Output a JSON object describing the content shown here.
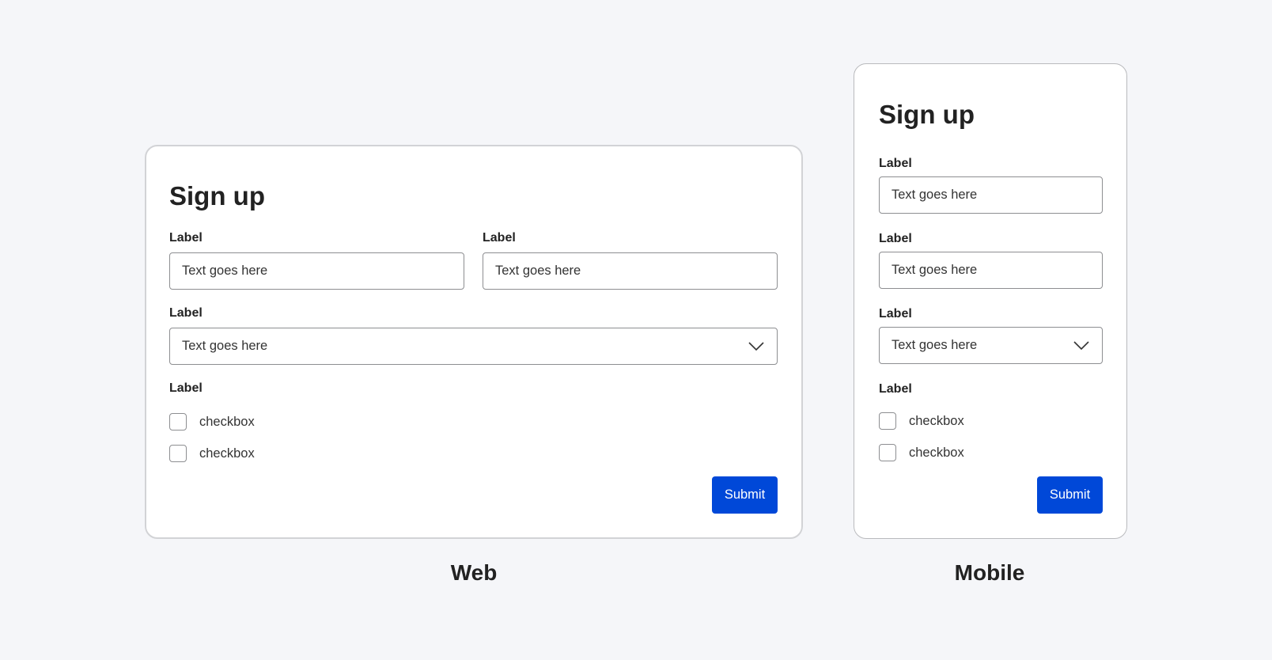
{
  "web": {
    "title": "Sign up",
    "fields": [
      {
        "label": "Label",
        "value": "Text goes here"
      },
      {
        "label": "Label",
        "value": "Text goes here"
      }
    ],
    "select": {
      "label": "Label",
      "value": "Text goes here"
    },
    "checkbox_group": {
      "label": "Label",
      "options": [
        "checkbox",
        "checkbox"
      ]
    },
    "submit_label": "Submit",
    "caption": "Web"
  },
  "mobile": {
    "title": "Sign up",
    "fields": [
      {
        "label": "Label",
        "value": "Text goes here"
      },
      {
        "label": "Label",
        "value": "Text goes here"
      }
    ],
    "select": {
      "label": "Label",
      "value": "Text goes here"
    },
    "checkbox_group": {
      "label": "Label",
      "options": [
        "checkbox",
        "checkbox"
      ]
    },
    "submit_label": "Submit",
    "caption": "Mobile"
  },
  "colors": {
    "accent": "#0048d8",
    "background": "#f5f6f9",
    "border": "#8d8e91"
  }
}
